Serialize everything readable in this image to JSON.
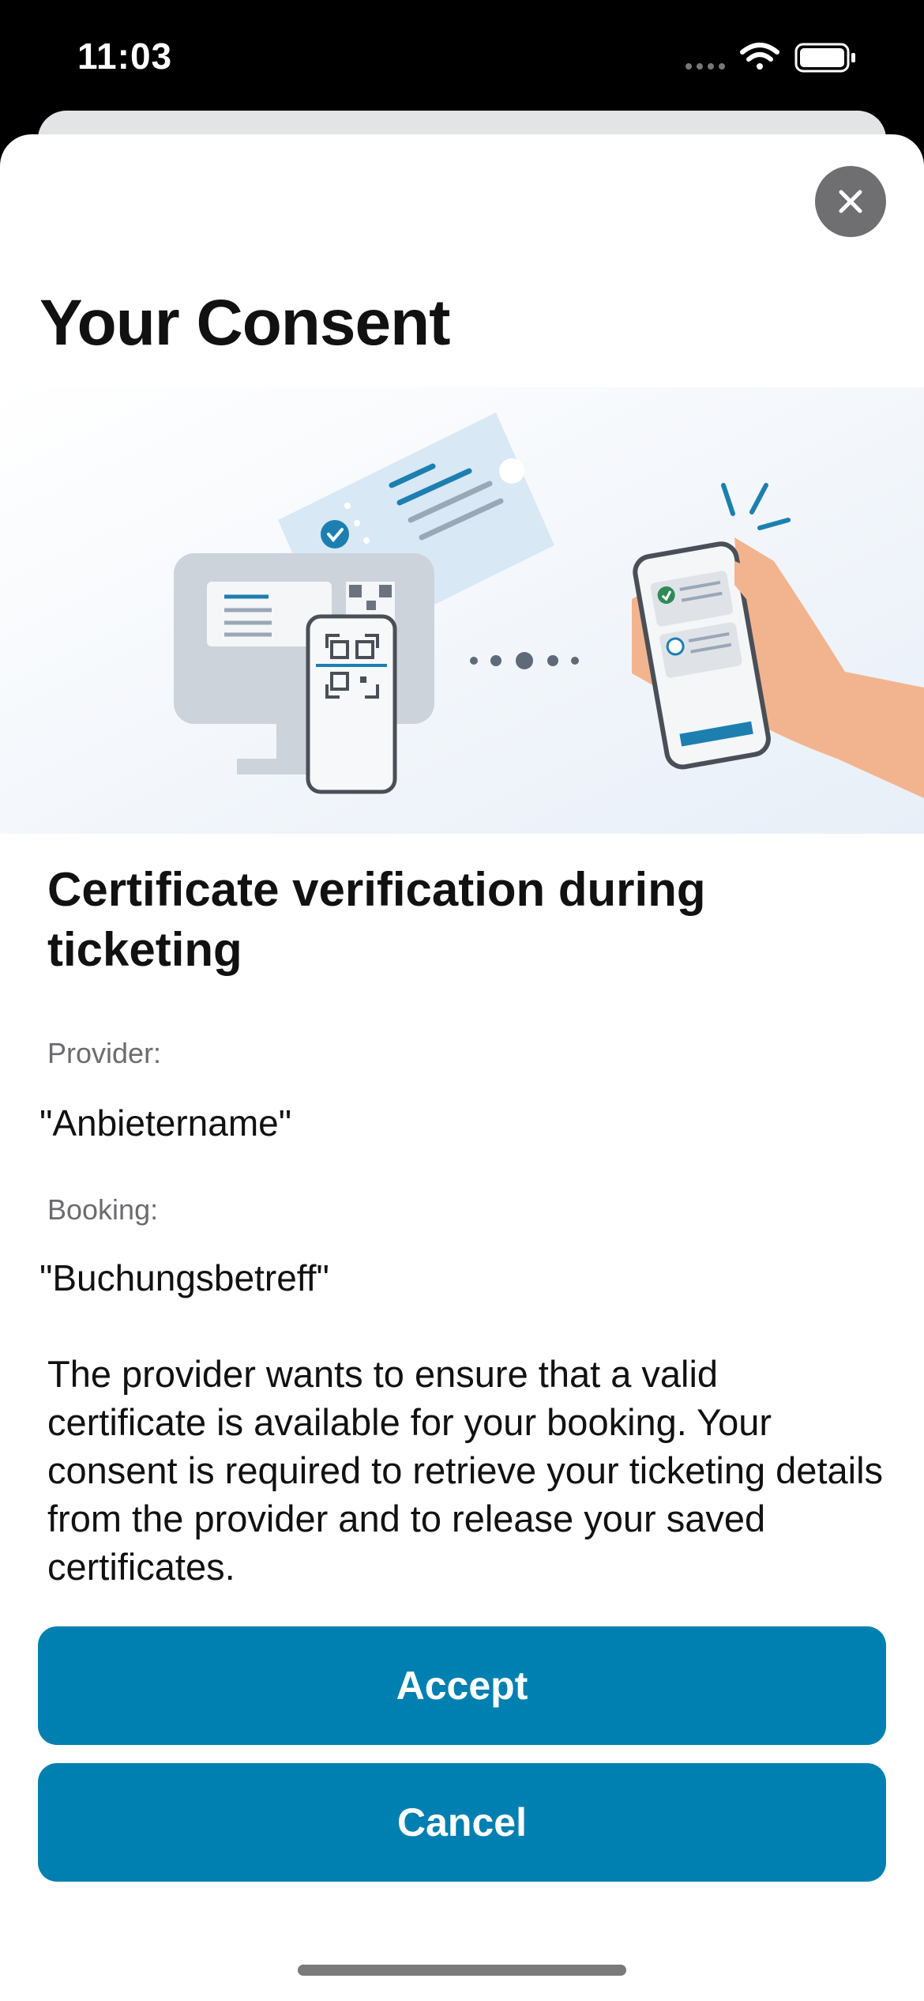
{
  "status_bar": {
    "time": "11:03"
  },
  "dialog": {
    "title": "Your Consent",
    "section_title": "Certificate verification during ticketing",
    "provider_label": "Provider:",
    "provider_value": "\"Anbietername\"",
    "booking_label": "Booking:",
    "booking_value": "\"Buchungsbetreff\"",
    "description": "The provider wants to ensure that a valid certificate is available for your booking. Your consent is required to retrieve your ticketing details from the provider and to release your saved certificates.",
    "accept_label": "Accept",
    "cancel_label": "Cancel",
    "close_icon": "close-icon"
  },
  "colors": {
    "primary": "#0080b0",
    "close_button": "#6f6f71",
    "label_gray": "#6b6b70",
    "illustration_accent": "#1c7fb0",
    "check_green": "#2e8b57"
  }
}
